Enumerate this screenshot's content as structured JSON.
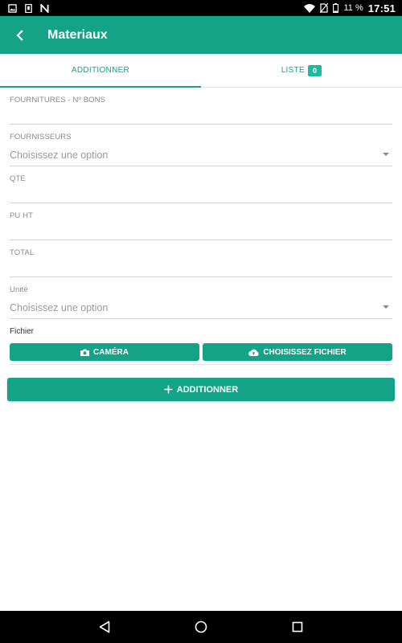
{
  "status_bar": {
    "battery_text": "11 %",
    "time": "17:51"
  },
  "app_bar": {
    "title": "Materiaux"
  },
  "tabs": [
    {
      "label": "ADDITIONNER",
      "active": true
    },
    {
      "label": "LISTE",
      "badge": "0",
      "active": false
    }
  ],
  "form": {
    "fournitures": {
      "label": "FOURNITURES - Nº BONS",
      "value": ""
    },
    "fournisseurs": {
      "label": "FOURNISSEURS",
      "value": "Choisissez une option"
    },
    "qte": {
      "label": "QTE",
      "value": ""
    },
    "pu_ht": {
      "label": "PU HT",
      "value": ""
    },
    "total": {
      "label": "TOTAL",
      "value": ""
    },
    "unite": {
      "label": "Unité",
      "value": "Choisissez une option"
    },
    "fichier": {
      "label": "Fichier",
      "camera_label": "CAMÉRA",
      "choose_label": "CHOISISSEZ FICHIER"
    },
    "submit_label": "ADDITIONNER"
  },
  "colors": {
    "primary": "#14a387",
    "badge": "#1fb99b"
  },
  "icons": [
    "image-icon",
    "sim-icon",
    "n-icon",
    "wifi-icon",
    "no-sim-icon",
    "battery-icon",
    "back-arrow-icon",
    "camera-icon",
    "cloud-upload-icon",
    "plus-icon",
    "nav-back-icon",
    "nav-home-icon",
    "nav-recents-icon"
  ]
}
